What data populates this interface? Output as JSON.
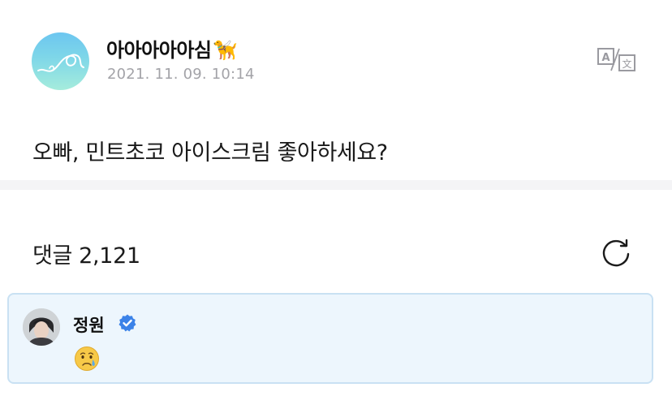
{
  "post": {
    "author": "아아아아아심",
    "author_emoji": "🦮",
    "date": "2021. 11. 09. 10:14",
    "body": "오빠, 민트초코 아이스크림 좋아하세요?"
  },
  "comments": {
    "label": "댓글",
    "count": "2,121"
  },
  "reply": {
    "name": "정원",
    "emoji": "😢"
  },
  "icons": {
    "translate": "translate-icon",
    "refresh": "refresh-icon",
    "verified": "verified-badge-icon"
  },
  "colors": {
    "verified": "#3b82e8",
    "card_bg": "#edf6fd",
    "card_border": "#c9e1f3",
    "date": "#a3a3a8"
  }
}
